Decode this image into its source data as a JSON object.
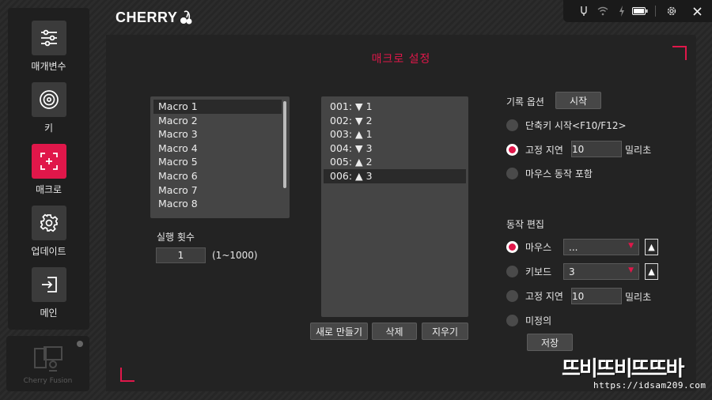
{
  "brand": {
    "name": "CHERRY"
  },
  "window": {
    "icons": [
      "usb-icon",
      "wifi-icon",
      "charging-icon",
      "battery-icon",
      "settings-icon",
      "close-icon"
    ]
  },
  "sidebar": {
    "items": [
      {
        "label": "매개변수",
        "icon": "sliders-icon",
        "active": false
      },
      {
        "label": "키",
        "icon": "key-target-icon",
        "active": false
      },
      {
        "label": "매크로",
        "icon": "macro-icon",
        "active": true
      },
      {
        "label": "업데이트",
        "icon": "gear-icon",
        "active": false
      },
      {
        "label": "메인",
        "icon": "exit-icon",
        "active": false
      }
    ],
    "fusion": {
      "label": "Cherry Fusion"
    }
  },
  "panel": {
    "title": "매크로 설정"
  },
  "macros": {
    "items": [
      "Macro 1",
      "Macro 2",
      "Macro 3",
      "Macro 4",
      "Macro 5",
      "Macro 6",
      "Macro 7",
      "Macro 8"
    ],
    "selected_index": 0
  },
  "execution": {
    "label": "실행 횟수",
    "value": "1",
    "range": "(1~1000)"
  },
  "steps": {
    "items": [
      "001: ▼ 1",
      "002: ▼ 2",
      "003: ▲ 1",
      "004: ▼ 3",
      "005: ▲ 2",
      "006: ▲ 3"
    ],
    "selected_index": 5
  },
  "step_buttons": {
    "new": "새로 만들기",
    "delete": "삭제",
    "clear": "지우기"
  },
  "record": {
    "label": "기록 옵션",
    "start_button": "시작",
    "options": {
      "hotkey": "단축키 시작<F10/F12>",
      "fixed_delay": "고정 지연",
      "mouse_include": "마우스 동작 포함"
    },
    "delay_value": "10",
    "delay_unit": "밀리초",
    "selected": "fixed_delay"
  },
  "edit": {
    "label": "동작 편집",
    "mouse_label": "마우스",
    "mouse_value": "...",
    "keyboard_label": "키보드",
    "keyboard_value": "3",
    "fixed_delay_label": "고정 지연",
    "delay_value": "10",
    "delay_unit": "밀리초",
    "undefined_label": "미정의",
    "save_button": "저장",
    "selected": "mouse"
  },
  "watermark": {
    "text": "뜨비뜨비뜨뜨바",
    "url": "https://idsam209.com"
  },
  "colors": {
    "accent": "#e0174a",
    "panel": "#232323",
    "list": "#454545"
  }
}
